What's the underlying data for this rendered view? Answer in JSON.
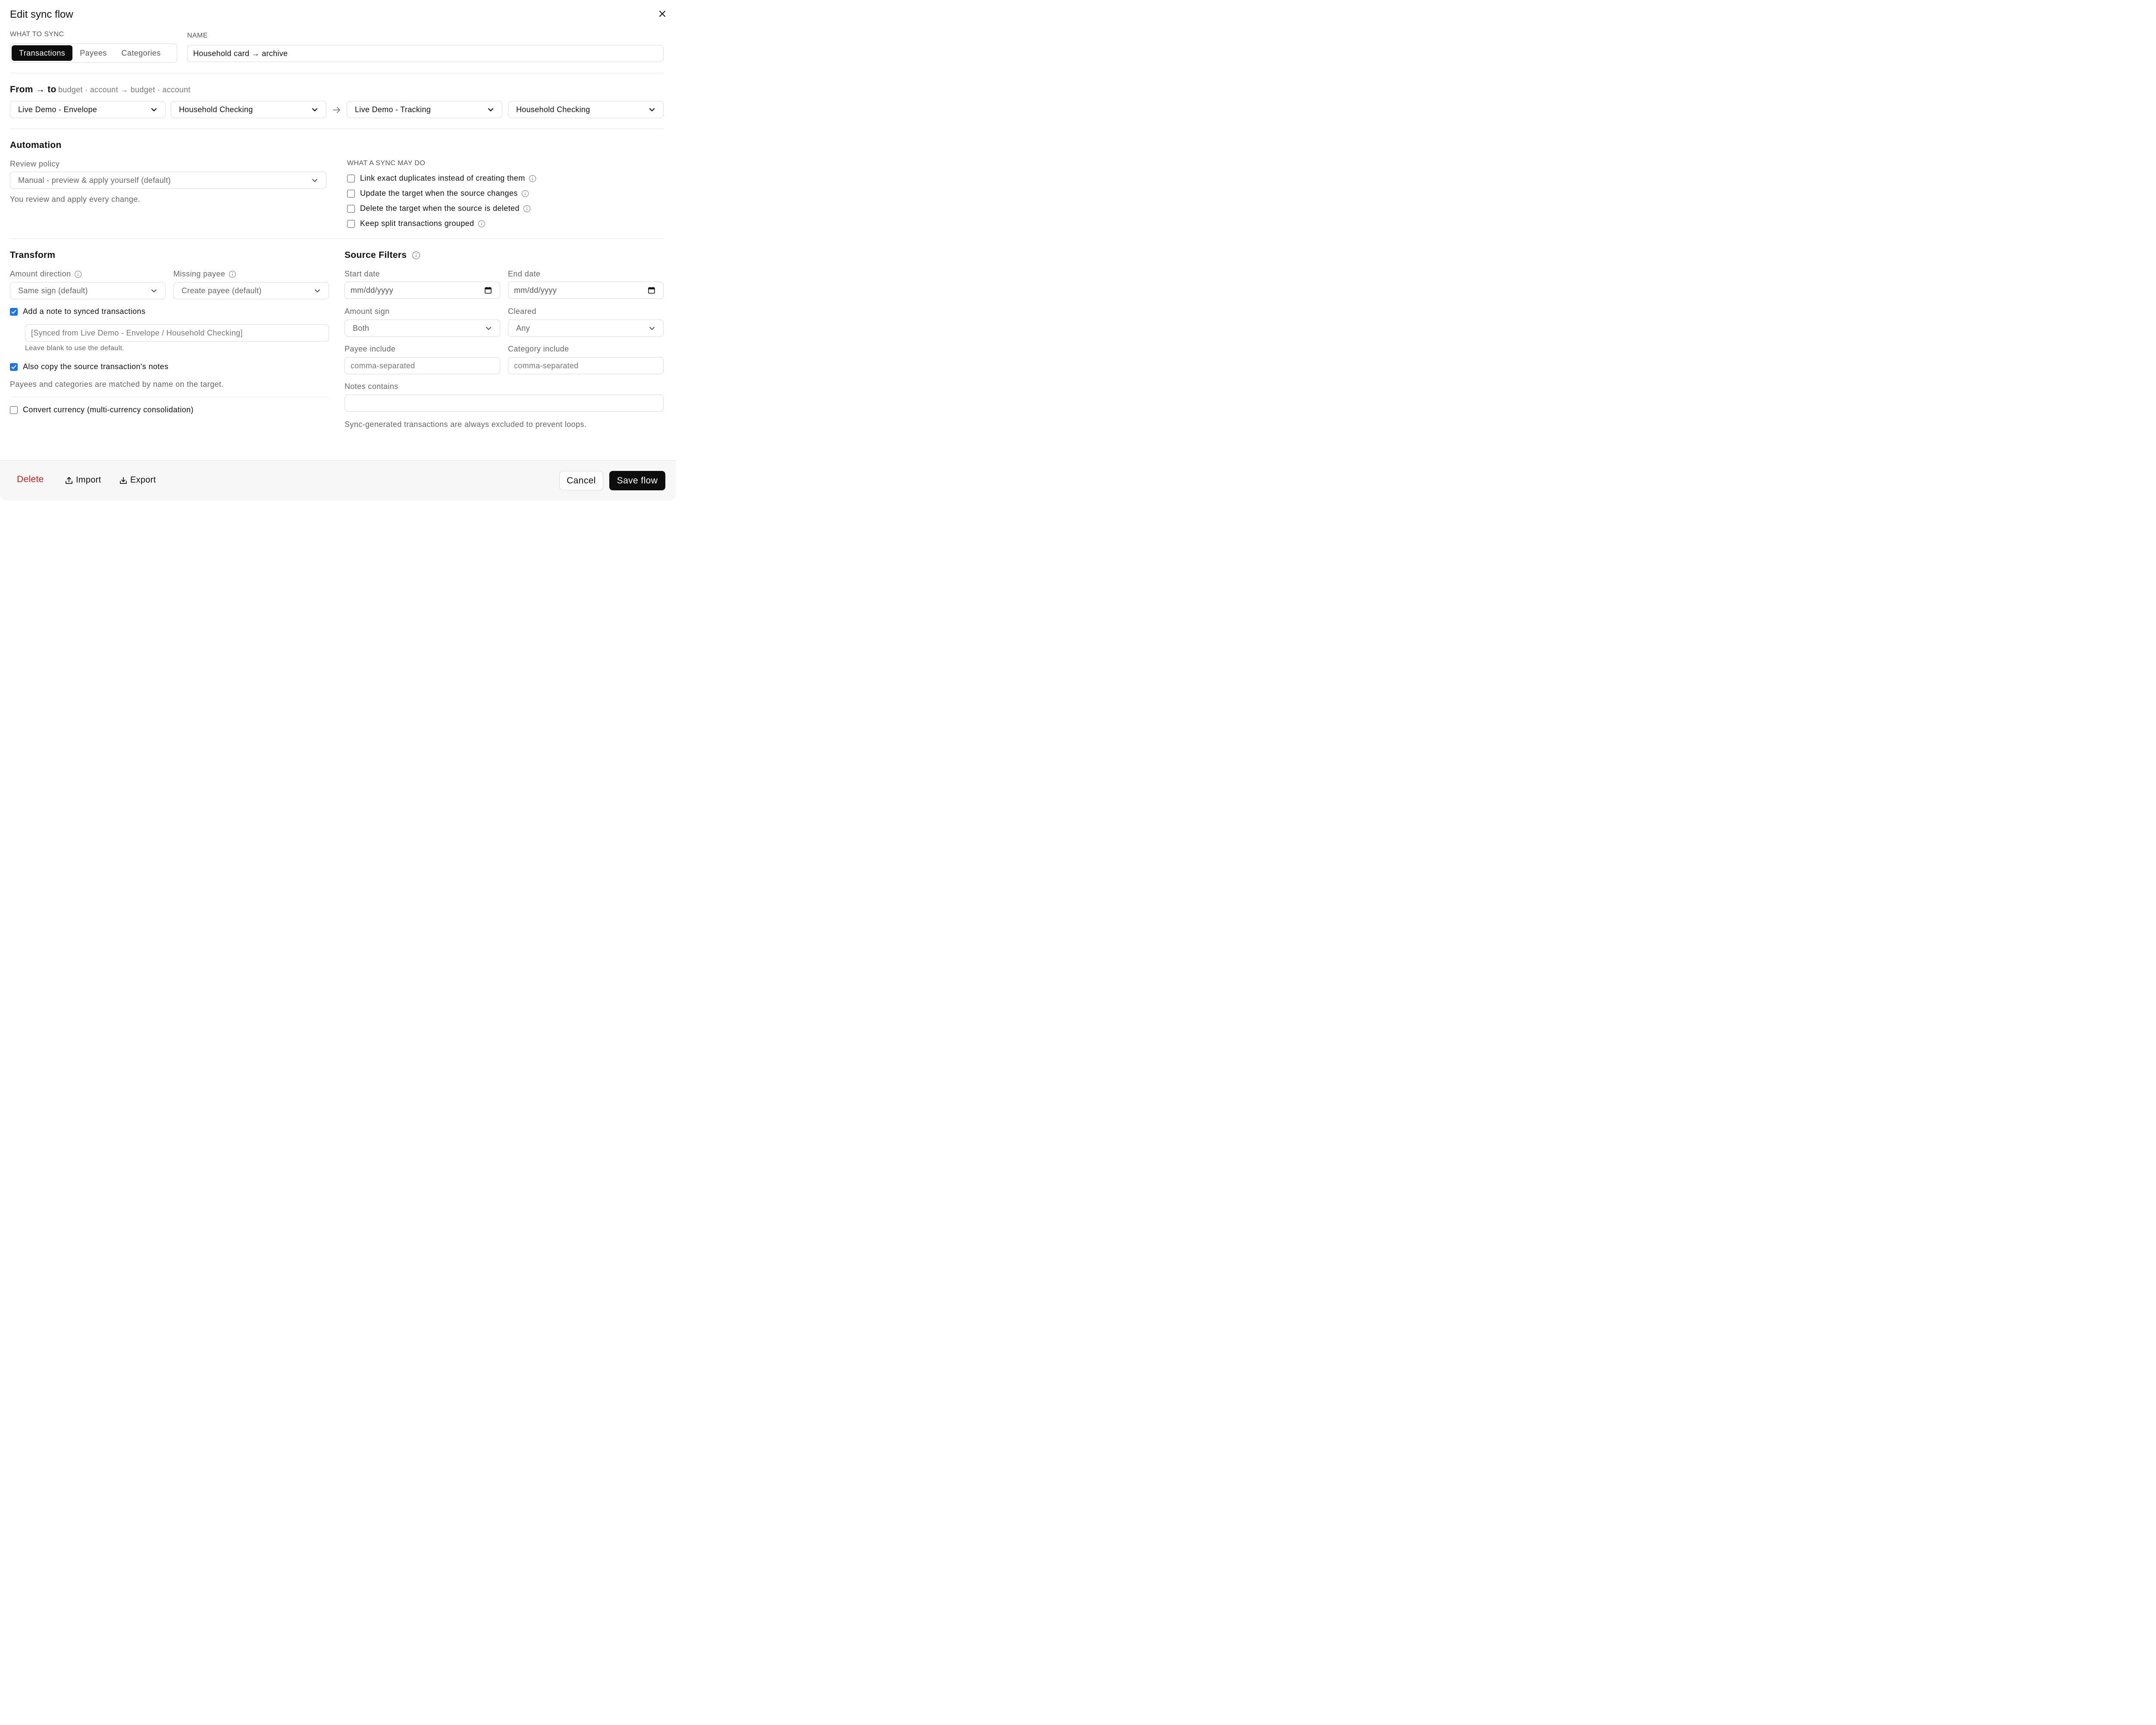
{
  "dialog": {
    "title": "Edit sync flow"
  },
  "what_to_sync": {
    "label": "WHAT TO SYNC",
    "options": [
      "Transactions",
      "Payees",
      "Categories"
    ],
    "selected": "Transactions"
  },
  "name": {
    "label": "NAME",
    "value": "Household card → archive"
  },
  "from_to": {
    "title": "From → to",
    "hint": "budget · account → budget · account",
    "source_budget": "Live Demo - Envelope",
    "source_account": "Household Checking",
    "target_budget": "Live Demo - Tracking",
    "target_account": "Household Checking"
  },
  "automation": {
    "title": "Automation",
    "review_label": "Review policy",
    "review_value": "Manual - preview & apply yourself (default)",
    "review_help": "You review and apply every change.",
    "may_do_label": "WHAT A SYNC MAY DO",
    "options": [
      {
        "label": "Link exact duplicates instead of creating them",
        "checked": false
      },
      {
        "label": "Update the target when the source changes",
        "checked": false
      },
      {
        "label": "Delete the target when the source is deleted",
        "checked": false
      },
      {
        "label": "Keep split transactions grouped",
        "checked": false
      }
    ]
  },
  "transform": {
    "title": "Transform",
    "amount_direction_label": "Amount direction",
    "amount_direction_value": "Same sign (default)",
    "missing_payee_label": "Missing payee",
    "missing_payee_value": "Create payee (default)",
    "add_note_label": "Add a note to synced transactions",
    "add_note_checked": true,
    "note_placeholder": "[Synced from Live Demo - Envelope / Household Checking]",
    "note_help": "Leave blank to use the default.",
    "copy_notes_label": "Also copy the source transaction's notes",
    "copy_notes_checked": true,
    "match_help": "Payees and categories are matched by name on the target.",
    "convert_label": "Convert currency (multi-currency consolidation)",
    "convert_checked": false
  },
  "filters": {
    "title": "Source Filters",
    "start_label": "Start date",
    "start_placeholder": "mm/dd/yyyy",
    "end_label": "End date",
    "end_placeholder": "mm/dd/yyyy",
    "amount_sign_label": "Amount sign",
    "amount_sign_value": "Both",
    "cleared_label": "Cleared",
    "cleared_value": "Any",
    "payee_label": "Payee include",
    "payee_placeholder": "comma-separated",
    "category_label": "Category include",
    "category_placeholder": "comma-separated",
    "notes_label": "Notes contains",
    "notes_value": "",
    "loop_help": "Sync-generated transactions are always excluded to prevent loops."
  },
  "footer": {
    "delete": "Delete",
    "import": "Import",
    "export": "Export",
    "cancel": "Cancel",
    "save": "Save flow"
  },
  "colors": {
    "primary": "#0d0d0d",
    "danger": "#c81e1e",
    "check": "#1a73e8"
  }
}
